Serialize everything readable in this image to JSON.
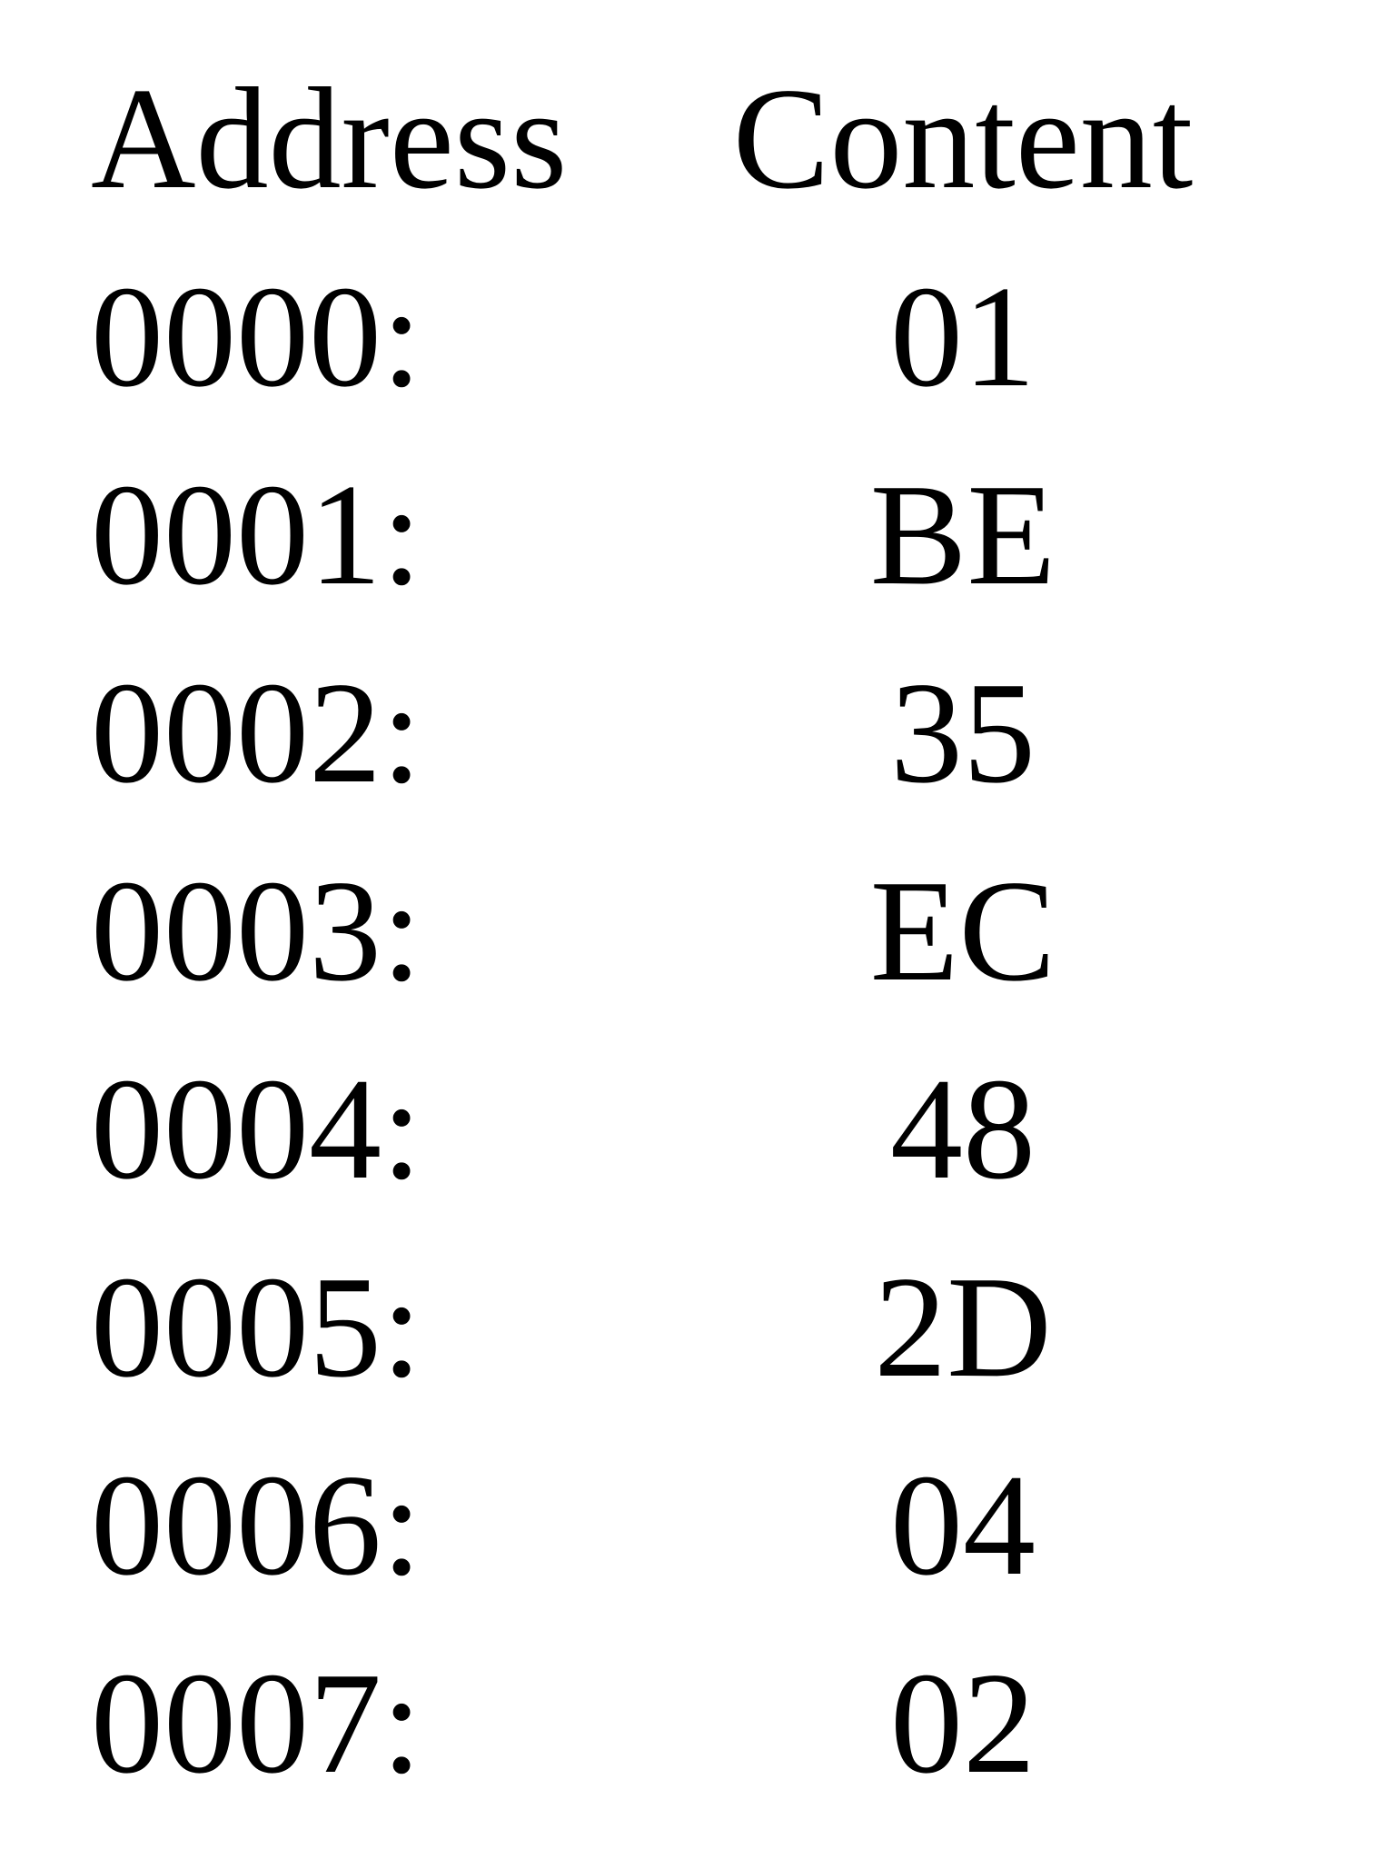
{
  "table": {
    "headers": {
      "address": "Address",
      "content": "Content"
    },
    "rows": [
      {
        "address": "0000:",
        "content": "01"
      },
      {
        "address": "0001:",
        "content": "BE"
      },
      {
        "address": "0002:",
        "content": "35"
      },
      {
        "address": "0003:",
        "content": "EC"
      },
      {
        "address": "0004:",
        "content": "48"
      },
      {
        "address": "0005:",
        "content": "2D"
      },
      {
        "address": "0006:",
        "content": "04"
      },
      {
        "address": "0007:",
        "content": "02"
      }
    ]
  }
}
